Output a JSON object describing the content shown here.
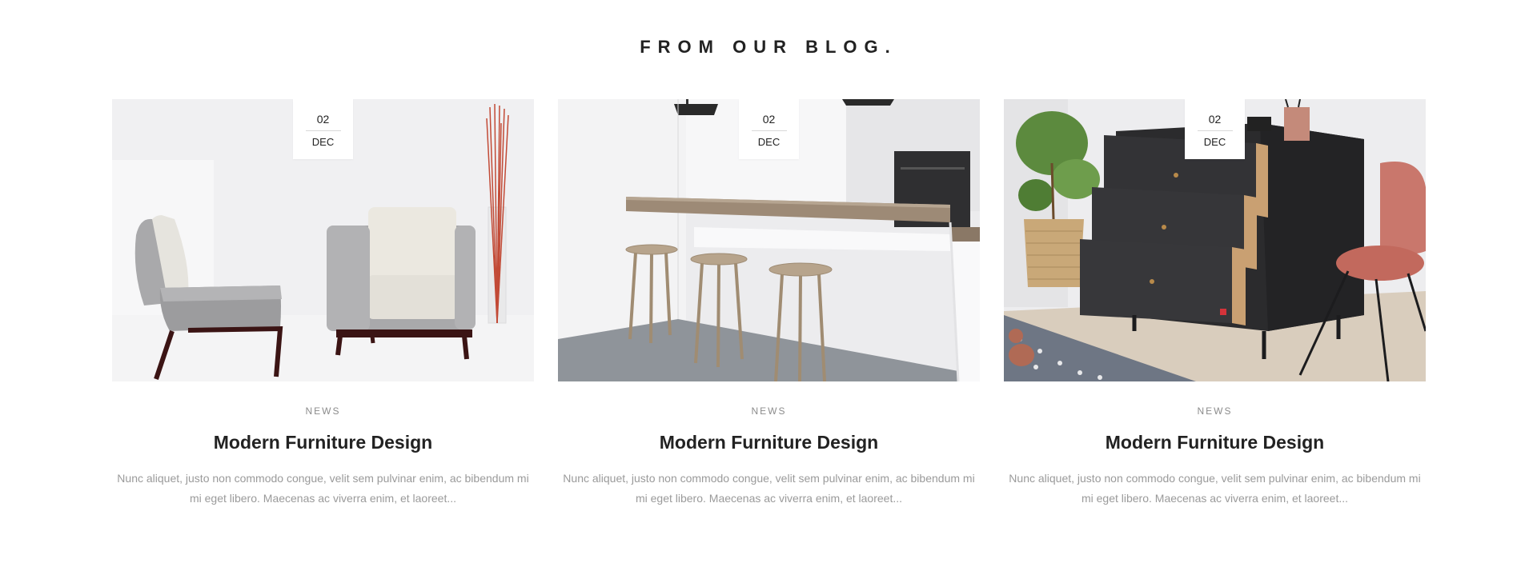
{
  "section": {
    "title": "FROM OUR BLOG."
  },
  "posts": [
    {
      "day": "02",
      "month": "DEC",
      "category": "NEWS",
      "title": "Modern Furniture Design",
      "excerpt": "Nunc aliquet, justo non commodo congue, velit sem pulvinar enim, ac bibendum mi mi eget libero. Maecenas ac viverra enim, et laoreet..."
    },
    {
      "day": "02",
      "month": "DEC",
      "category": "NEWS",
      "title": "Modern Furniture Design",
      "excerpt": "Nunc aliquet, justo non commodo congue, velit sem pulvinar enim, ac bibendum mi mi eget libero. Maecenas ac viverra enim, et laoreet..."
    },
    {
      "day": "02",
      "month": "DEC",
      "category": "NEWS",
      "title": "Modern Furniture Design",
      "excerpt": "Nunc aliquet, justo non commodo congue, velit sem pulvinar enim, ac bibendum mi mi eget libero. Maecenas ac viverra enim, et laoreet..."
    }
  ]
}
